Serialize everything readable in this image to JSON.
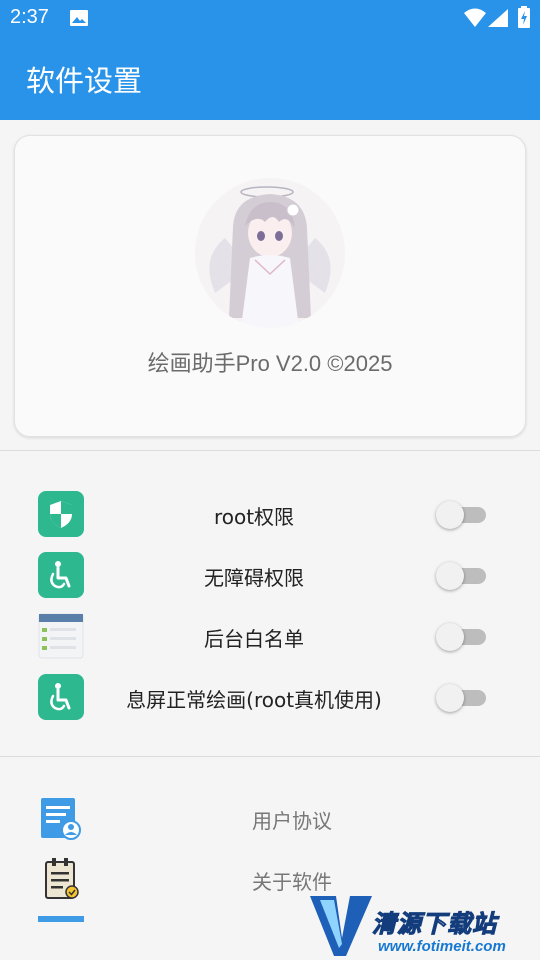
{
  "status_bar": {
    "time": "2:37",
    "icons": [
      "image-icon",
      "wifi-icon",
      "signal-icon",
      "battery-icon"
    ]
  },
  "app_bar": {
    "title": "软件设置"
  },
  "profile": {
    "avatar": "anime-girl-avatar",
    "version_text": "绘画助手Pro V2.0 ©2025"
  },
  "permissions": [
    {
      "icon": "shield-icon",
      "label": "root权限",
      "enabled": false
    },
    {
      "icon": "accessibility-icon",
      "label": "无障碍权限",
      "enabled": false
    },
    {
      "icon": "window-list-icon",
      "label": "后台白名单",
      "enabled": false
    },
    {
      "icon": "accessibility-icon",
      "label": "息屏正常绘画(root真机使用)",
      "enabled": false
    }
  ],
  "links": [
    {
      "icon": "user-agreement-icon",
      "label": "用户协议"
    },
    {
      "icon": "clipboard-check-icon",
      "label": "关于软件"
    }
  ],
  "watermark": {
    "title": "清源下载站",
    "url": "www.fotimeit.com"
  },
  "colors": {
    "primary": "#2893e8",
    "accent_green": "#2db890",
    "toggle_off_track": "#bdbdbd"
  }
}
